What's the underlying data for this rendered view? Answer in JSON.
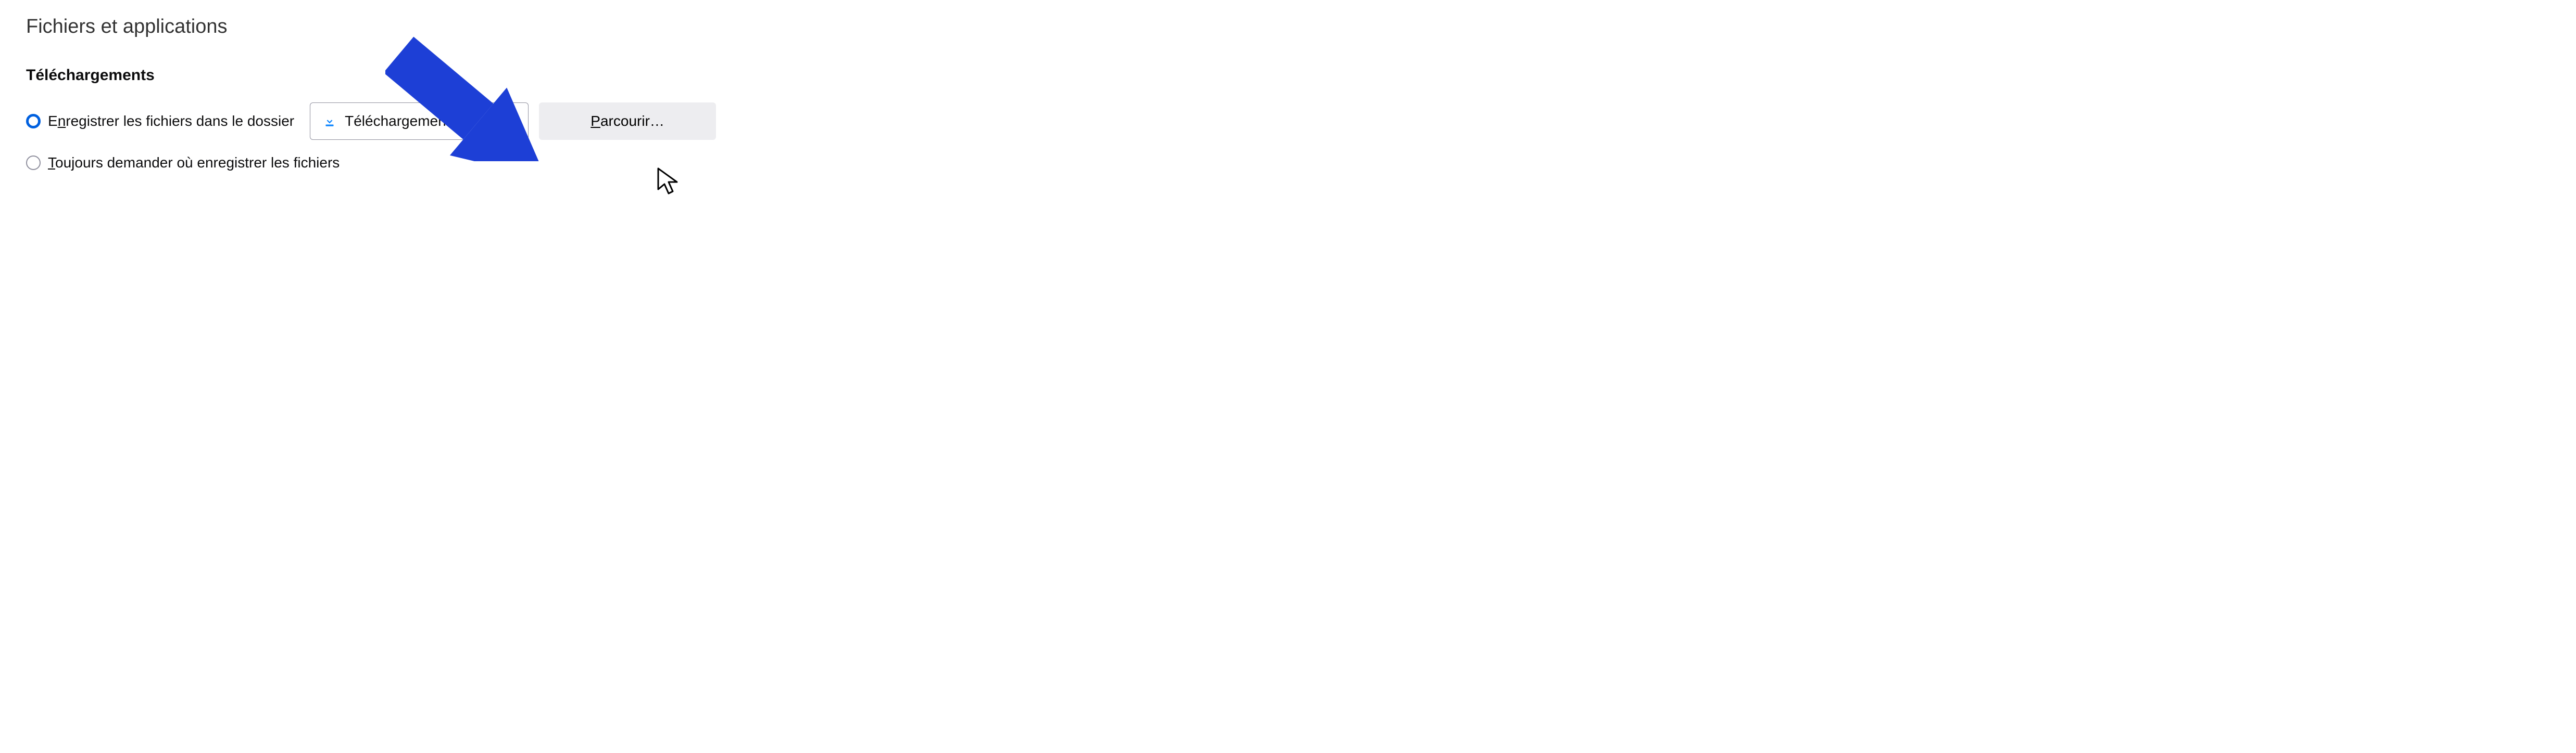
{
  "section": {
    "title": "Fichiers et applications"
  },
  "downloads": {
    "title": "Téléchargements",
    "option_save_prefix": "E",
    "option_save_accesskey": "n",
    "option_save_suffix": "registrer les fichiers dans le dossier",
    "folder_name": "Téléchargements",
    "browse_accesskey": "P",
    "browse_suffix": "arcourir…",
    "option_ask_accesskey": "T",
    "option_ask_suffix": "oujours demander où enregistrer les fichiers"
  },
  "colors": {
    "accent": "#0060df",
    "arrow": "#1d3fd6"
  }
}
